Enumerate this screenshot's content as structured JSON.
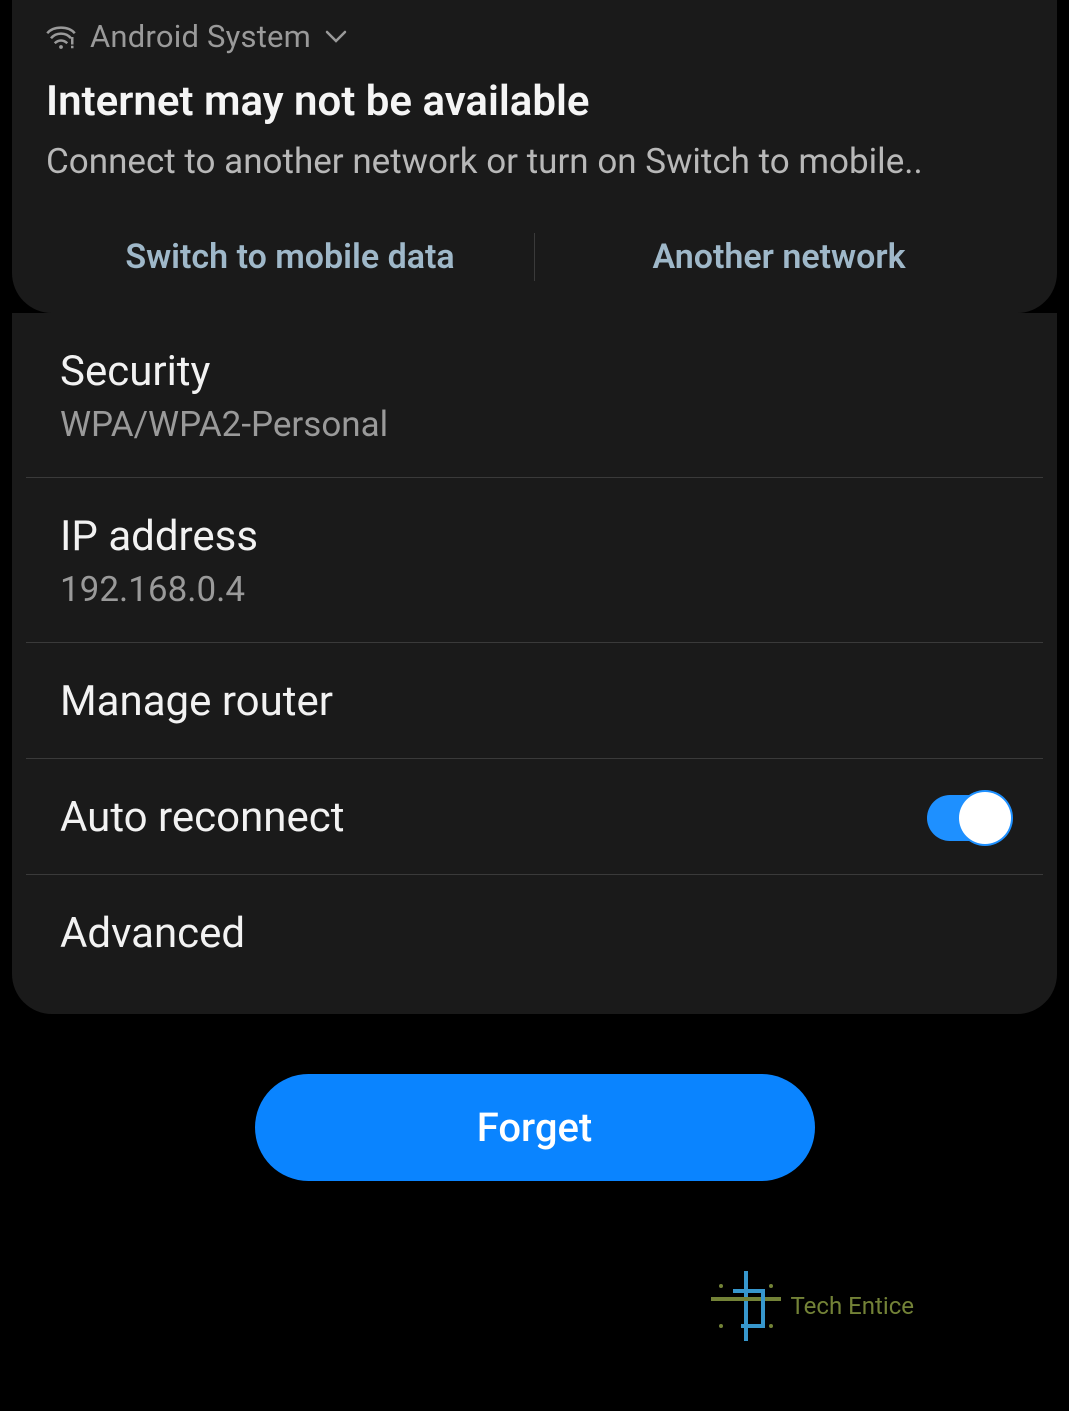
{
  "notification": {
    "system_label": "Android System",
    "title": "Internet may not be available",
    "body": "Connect to another network or turn on Switch to mobile..",
    "action_switch": "Switch to mobile data",
    "action_another": "Another network"
  },
  "settings": {
    "security": {
      "label": "Security",
      "value": "WPA/WPA2-Personal"
    },
    "ip": {
      "label": "IP address",
      "value": "192.168.0.4"
    },
    "manage_router": {
      "label": "Manage router"
    },
    "auto_reconnect": {
      "label": "Auto reconnect",
      "enabled": true
    },
    "advanced": {
      "label": "Advanced"
    }
  },
  "forget_button": "Forget",
  "watermark": "Tech Entice",
  "colors": {
    "accent": "#0a84ff",
    "toggle": "#1e90ff",
    "bg_card": "#1a1a1a"
  }
}
